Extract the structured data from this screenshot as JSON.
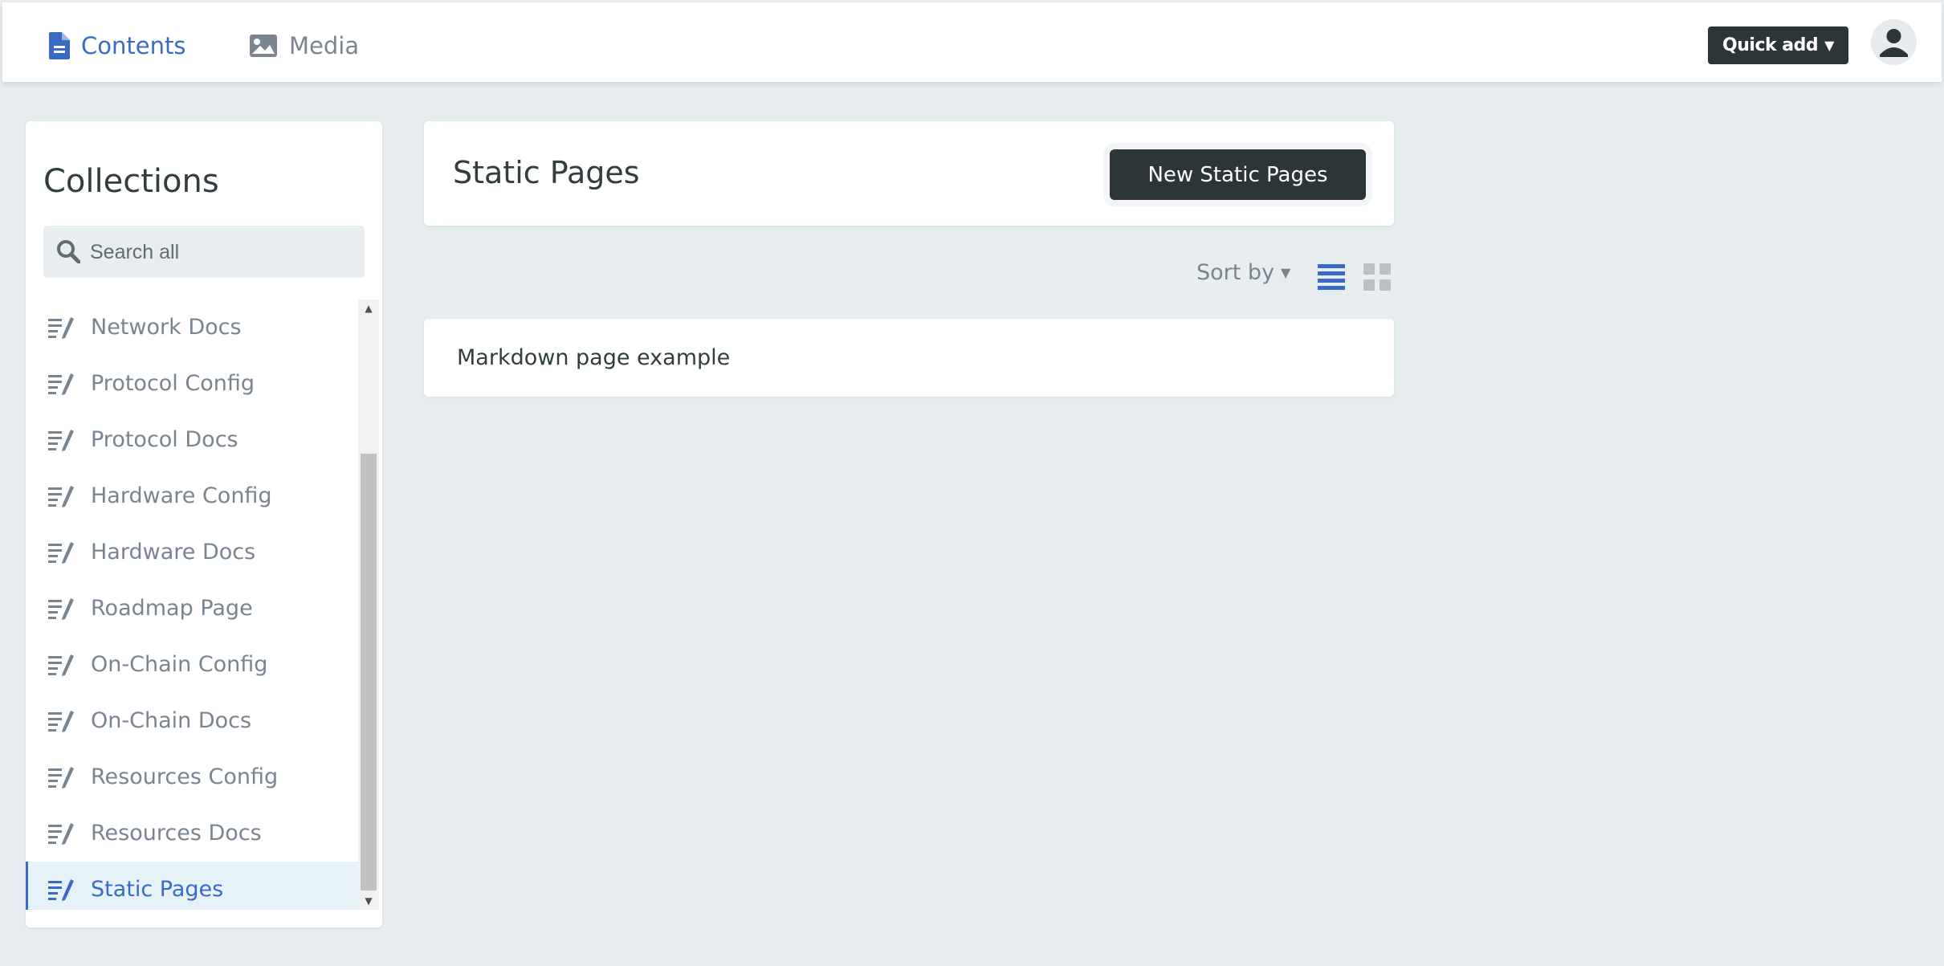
{
  "topbar": {
    "tabs": [
      {
        "label": "Contents",
        "icon": "document-icon",
        "active": true
      },
      {
        "label": "Media",
        "icon": "image-icon",
        "active": false
      }
    ],
    "quick_add_label": "Quick add",
    "avatar_icon": "user-icon"
  },
  "sidebar": {
    "title": "Collections",
    "search_placeholder": "Search all",
    "items": [
      {
        "label": "Network Docs"
      },
      {
        "label": "Protocol Config"
      },
      {
        "label": "Protocol Docs"
      },
      {
        "label": "Hardware Config"
      },
      {
        "label": "Hardware Docs"
      },
      {
        "label": "Roadmap Page"
      },
      {
        "label": "On-Chain Config"
      },
      {
        "label": "On-Chain Docs"
      },
      {
        "label": "Resources Config"
      },
      {
        "label": "Resources Docs"
      },
      {
        "label": "Static Pages",
        "active": true
      }
    ]
  },
  "main": {
    "title": "Static Pages",
    "new_button_label": "New Static Pages",
    "sort_by_label": "Sort by",
    "view_mode": "list",
    "entries": [
      {
        "title": "Markdown page example"
      }
    ]
  },
  "colors": {
    "accent": "#3a6bc4",
    "dark_button": "#2c3538",
    "background": "#e8eef0",
    "muted_text": "#798491"
  }
}
